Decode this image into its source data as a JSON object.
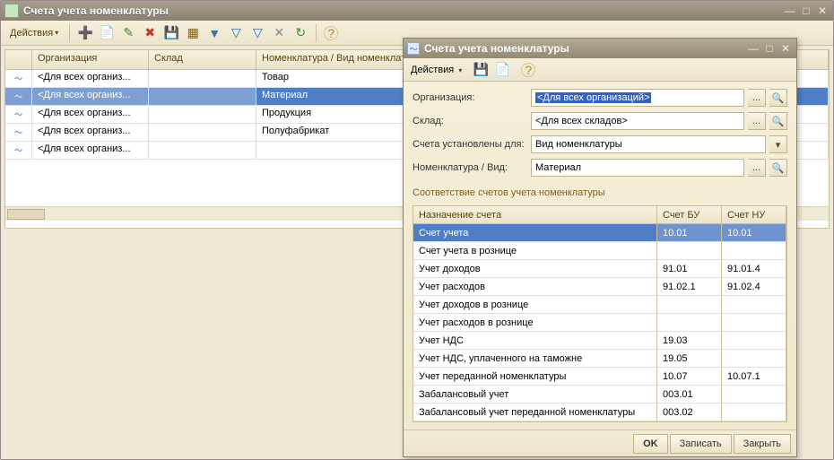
{
  "mainWindow": {
    "title": "Счета учета номенклатуры",
    "actionsLabel": "Действия",
    "columns": {
      "org": "Организация",
      "sklad": "Склад",
      "nom": "Номенклатура / Вид номенклатуры"
    },
    "rows": [
      {
        "org": "<Для всех организ...",
        "sklad": "",
        "nom": "Товар",
        "selected": false
      },
      {
        "org": "<Для всех организ...",
        "sklad": "",
        "nom": "Материал",
        "selected": true
      },
      {
        "org": "<Для всех организ...",
        "sklad": "",
        "nom": "Продукция",
        "selected": false
      },
      {
        "org": "<Для всех организ...",
        "sklad": "",
        "nom": "Полуфабрикат",
        "selected": false
      },
      {
        "org": "<Для всех организ...",
        "sklad": "",
        "nom": "",
        "selected": false
      }
    ]
  },
  "cardWindow": {
    "title": "Счета учета номенклатуры",
    "actionsLabel": "Действия",
    "fields": {
      "orgLabel": "Организация:",
      "orgValue": "<Для всех организаций>",
      "skladLabel": "Склад:",
      "skladValue": "<Для всех складов>",
      "setForLabel": "Счета установлены для:",
      "setForValue": "Вид номенклатуры",
      "nomLabel": "Номенклатура / Вид:",
      "nomValue": "Материал"
    },
    "subTitle": "Соответствие счетов учета номенклатуры",
    "accHeader": {
      "name": "Назначение счета",
      "bu": "Счет БУ",
      "nu": "Счет НУ"
    },
    "accRows": [
      {
        "name": "Счет учета",
        "bu": "10.01",
        "nu": "10.01",
        "selected": true
      },
      {
        "name": "Счет учета в рознице",
        "bu": "",
        "nu": ""
      },
      {
        "name": "Учет доходов",
        "bu": "91.01",
        "nu": "91.01.4"
      },
      {
        "name": "Учет расходов",
        "bu": "91.02.1",
        "nu": "91.02.4"
      },
      {
        "name": "Учет доходов в рознице",
        "bu": "",
        "nu": ""
      },
      {
        "name": "Учет расходов в рознице",
        "bu": "",
        "nu": ""
      },
      {
        "name": "Учет НДС",
        "bu": "19.03",
        "nu": ""
      },
      {
        "name": "Учет НДС, уплаченного на таможне",
        "bu": "19.05",
        "nu": ""
      },
      {
        "name": "Учет переданной номенклатуры",
        "bu": "10.07",
        "nu": "10.07.1"
      },
      {
        "name": "Забалансовый учет",
        "bu": "003.01",
        "nu": ""
      },
      {
        "name": "Забалансовый учет переданной номенклатуры",
        "bu": "003.02",
        "nu": ""
      }
    ],
    "buttons": {
      "ok": "OK",
      "write": "Записать",
      "close": "Закрыть"
    }
  },
  "glyphs": {
    "minimize": "—",
    "maximize": "□",
    "close": "✕",
    "dropdown": "▾",
    "ellipsis": "...",
    "lookup": "🔍",
    "add": "➕",
    "copy": "📄",
    "edit": "✎",
    "delete": "✖",
    "save": "💾",
    "select": "▦",
    "filter1": "▼",
    "filter2": "▽",
    "filter3": "▽",
    "filterOff": "✕",
    "refresh": "↻",
    "help": "?",
    "mark": "～"
  }
}
